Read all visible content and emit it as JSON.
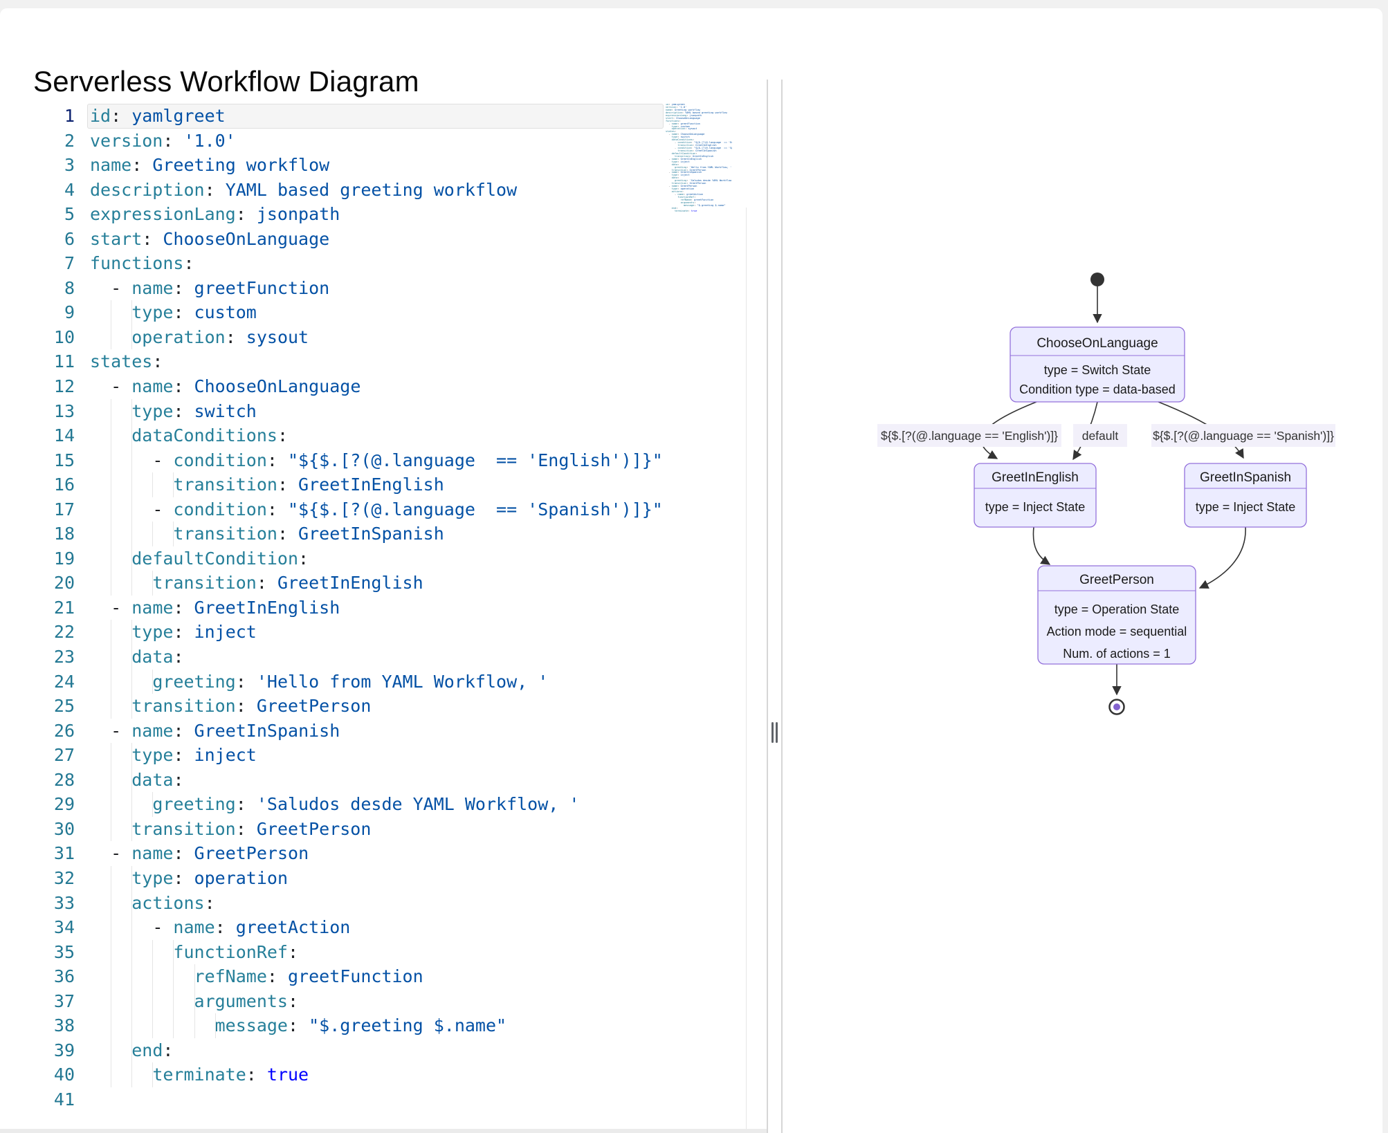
{
  "page": {
    "title": "Serverless Workflow Diagram"
  },
  "colors": {
    "key": "#267f99",
    "value": "#0451a5",
    "boolean": "#0000ff",
    "punctuation": "#202124",
    "line_number": "#237893",
    "line_number_active": "#0b216f",
    "node_fill": "#ececff",
    "node_border": "#9370db",
    "edge": "#333333",
    "label_bg": "#f2f0fa",
    "end_dot": "#8362ce"
  },
  "editor": {
    "active_line": 1,
    "lines": [
      {
        "t": [
          [
            "k",
            "id"
          ],
          [
            "c",
            ":"
          ],
          [
            "v",
            " yamlgreet"
          ]
        ]
      },
      {
        "t": [
          [
            "k",
            "version"
          ],
          [
            "c",
            ":"
          ],
          [
            "v",
            " '1.0'"
          ]
        ]
      },
      {
        "t": [
          [
            "k",
            "name"
          ],
          [
            "c",
            ":"
          ],
          [
            "v",
            " Greeting workflow"
          ]
        ]
      },
      {
        "t": [
          [
            "k",
            "description"
          ],
          [
            "c",
            ":"
          ],
          [
            "v",
            " YAML based greeting workflow"
          ]
        ]
      },
      {
        "t": [
          [
            "k",
            "expressionLang"
          ],
          [
            "c",
            ":"
          ],
          [
            "v",
            " jsonpath"
          ]
        ]
      },
      {
        "t": [
          [
            "k",
            "start"
          ],
          [
            "c",
            ":"
          ],
          [
            "v",
            " ChooseOnLanguage"
          ]
        ]
      },
      {
        "t": [
          [
            "k",
            "functions"
          ],
          [
            "c",
            ":"
          ]
        ]
      },
      {
        "t": [
          [
            "w",
            "  "
          ],
          [
            "d",
            "- "
          ],
          [
            "k",
            "name"
          ],
          [
            "c",
            ":"
          ],
          [
            "v",
            " greetFunction"
          ]
        ]
      },
      {
        "t": [
          [
            "w",
            "    "
          ],
          [
            "k",
            "type"
          ],
          [
            "c",
            ":"
          ],
          [
            "v",
            " custom"
          ]
        ]
      },
      {
        "t": [
          [
            "w",
            "    "
          ],
          [
            "k",
            "operation"
          ],
          [
            "c",
            ":"
          ],
          [
            "v",
            " sysout"
          ]
        ]
      },
      {
        "t": [
          [
            "k",
            "states"
          ],
          [
            "c",
            ":"
          ]
        ]
      },
      {
        "t": [
          [
            "w",
            "  "
          ],
          [
            "d",
            "- "
          ],
          [
            "k",
            "name"
          ],
          [
            "c",
            ":"
          ],
          [
            "v",
            " ChooseOnLanguage"
          ]
        ]
      },
      {
        "t": [
          [
            "w",
            "    "
          ],
          [
            "k",
            "type"
          ],
          [
            "c",
            ":"
          ],
          [
            "v",
            " switch"
          ]
        ]
      },
      {
        "t": [
          [
            "w",
            "    "
          ],
          [
            "k",
            "dataConditions"
          ],
          [
            "c",
            ":"
          ]
        ]
      },
      {
        "t": [
          [
            "w",
            "      "
          ],
          [
            "d",
            "- "
          ],
          [
            "k",
            "condition"
          ],
          [
            "c",
            ":"
          ],
          [
            "v",
            " \"${$.[?(@.language  == 'English')]}\""
          ]
        ]
      },
      {
        "t": [
          [
            "w",
            "        "
          ],
          [
            "k",
            "transition"
          ],
          [
            "c",
            ":"
          ],
          [
            "v",
            " GreetInEnglish"
          ]
        ]
      },
      {
        "t": [
          [
            "w",
            "      "
          ],
          [
            "d",
            "- "
          ],
          [
            "k",
            "condition"
          ],
          [
            "c",
            ":"
          ],
          [
            "v",
            " \"${$.[?(@.language  == 'Spanish')]}\""
          ]
        ]
      },
      {
        "t": [
          [
            "w",
            "        "
          ],
          [
            "k",
            "transition"
          ],
          [
            "c",
            ":"
          ],
          [
            "v",
            " GreetInSpanish"
          ]
        ]
      },
      {
        "t": [
          [
            "w",
            "    "
          ],
          [
            "k",
            "defaultCondition"
          ],
          [
            "c",
            ":"
          ]
        ]
      },
      {
        "t": [
          [
            "w",
            "      "
          ],
          [
            "k",
            "transition"
          ],
          [
            "c",
            ":"
          ],
          [
            "v",
            " GreetInEnglish"
          ]
        ]
      },
      {
        "t": [
          [
            "w",
            "  "
          ],
          [
            "d",
            "- "
          ],
          [
            "k",
            "name"
          ],
          [
            "c",
            ":"
          ],
          [
            "v",
            " GreetInEnglish"
          ]
        ]
      },
      {
        "t": [
          [
            "w",
            "    "
          ],
          [
            "k",
            "type"
          ],
          [
            "c",
            ":"
          ],
          [
            "v",
            " inject"
          ]
        ]
      },
      {
        "t": [
          [
            "w",
            "    "
          ],
          [
            "k",
            "data"
          ],
          [
            "c",
            ":"
          ]
        ]
      },
      {
        "t": [
          [
            "w",
            "      "
          ],
          [
            "k",
            "greeting"
          ],
          [
            "c",
            ":"
          ],
          [
            "v",
            " 'Hello from YAML Workflow, '"
          ]
        ]
      },
      {
        "t": [
          [
            "w",
            "    "
          ],
          [
            "k",
            "transition"
          ],
          [
            "c",
            ":"
          ],
          [
            "v",
            " GreetPerson"
          ]
        ]
      },
      {
        "t": [
          [
            "w",
            "  "
          ],
          [
            "d",
            "- "
          ],
          [
            "k",
            "name"
          ],
          [
            "c",
            ":"
          ],
          [
            "v",
            " GreetInSpanish"
          ]
        ]
      },
      {
        "t": [
          [
            "w",
            "    "
          ],
          [
            "k",
            "type"
          ],
          [
            "c",
            ":"
          ],
          [
            "v",
            " inject"
          ]
        ]
      },
      {
        "t": [
          [
            "w",
            "    "
          ],
          [
            "k",
            "data"
          ],
          [
            "c",
            ":"
          ]
        ]
      },
      {
        "t": [
          [
            "w",
            "      "
          ],
          [
            "k",
            "greeting"
          ],
          [
            "c",
            ":"
          ],
          [
            "v",
            " 'Saludos desde YAML Workflow, '"
          ]
        ]
      },
      {
        "t": [
          [
            "w",
            "    "
          ],
          [
            "k",
            "transition"
          ],
          [
            "c",
            ":"
          ],
          [
            "v",
            " GreetPerson"
          ]
        ]
      },
      {
        "t": [
          [
            "w",
            "  "
          ],
          [
            "d",
            "- "
          ],
          [
            "k",
            "name"
          ],
          [
            "c",
            ":"
          ],
          [
            "v",
            " GreetPerson"
          ]
        ]
      },
      {
        "t": [
          [
            "w",
            "    "
          ],
          [
            "k",
            "type"
          ],
          [
            "c",
            ":"
          ],
          [
            "v",
            " operation"
          ]
        ]
      },
      {
        "t": [
          [
            "w",
            "    "
          ],
          [
            "k",
            "actions"
          ],
          [
            "c",
            ":"
          ]
        ]
      },
      {
        "t": [
          [
            "w",
            "      "
          ],
          [
            "d",
            "- "
          ],
          [
            "k",
            "name"
          ],
          [
            "c",
            ":"
          ],
          [
            "v",
            " greetAction"
          ]
        ]
      },
      {
        "t": [
          [
            "w",
            "        "
          ],
          [
            "k",
            "functionRef"
          ],
          [
            "c",
            ":"
          ]
        ]
      },
      {
        "t": [
          [
            "w",
            "          "
          ],
          [
            "k",
            "refName"
          ],
          [
            "c",
            ":"
          ],
          [
            "v",
            " greetFunction"
          ]
        ]
      },
      {
        "t": [
          [
            "w",
            "          "
          ],
          [
            "k",
            "arguments"
          ],
          [
            "c",
            ":"
          ]
        ]
      },
      {
        "t": [
          [
            "w",
            "            "
          ],
          [
            "k",
            "message"
          ],
          [
            "c",
            ":"
          ],
          [
            "v",
            " \"$.greeting $.name\""
          ]
        ]
      },
      {
        "t": [
          [
            "w",
            "    "
          ],
          [
            "k",
            "end"
          ],
          [
            "c",
            ":"
          ]
        ]
      },
      {
        "t": [
          [
            "w",
            "      "
          ],
          [
            "k",
            "terminate"
          ],
          [
            "c",
            ":"
          ],
          [
            "v",
            " "
          ],
          [
            "b",
            "true"
          ]
        ]
      },
      {
        "t": []
      }
    ]
  },
  "diagram": {
    "nodes": [
      {
        "id": "ChooseOnLanguage",
        "title": "ChooseOnLanguage",
        "body": [
          "type = Switch State",
          "Condition type = data-based"
        ]
      },
      {
        "id": "GreetInEnglish",
        "title": "GreetInEnglish",
        "body": [
          "type = Inject State"
        ]
      },
      {
        "id": "GreetInSpanish",
        "title": "GreetInSpanish",
        "body": [
          "type = Inject State"
        ]
      },
      {
        "id": "GreetPerson",
        "title": "GreetPerson",
        "body": [
          "type = Operation State",
          "Action mode = sequential",
          "Num. of actions = 1"
        ]
      }
    ],
    "edge_labels": [
      "${$.[?(@.language == 'English')]}",
      "default",
      "${$.[?(@.language == 'Spanish')]}"
    ]
  }
}
